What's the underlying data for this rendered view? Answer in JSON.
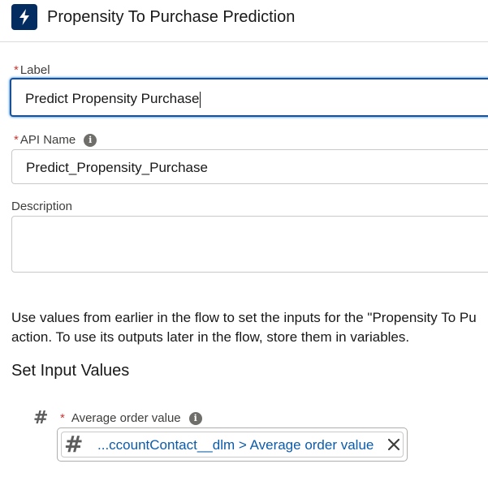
{
  "header": {
    "icon": "lightning-bolt-icon",
    "icon_color": "#032d60",
    "title": "Propensity To Purchase Prediction"
  },
  "label_field": {
    "required_mark": "*",
    "label": "Label",
    "value": "Predict Propensity Purchase"
  },
  "api_name_field": {
    "required_mark": "*",
    "label": "API Name",
    "info_icon": "info-icon",
    "value": "Predict_Propensity_Purchase"
  },
  "description_field": {
    "label": "Description",
    "value": ""
  },
  "help_text": {
    "line1": "Use values from earlier in the flow to set the inputs for the \"Propensity To Pu",
    "line2": "action. To use its outputs later in the flow, store them in variables."
  },
  "inputs_section": {
    "title": "Set Input Values",
    "items": [
      {
        "type_icon": "number-icon",
        "required_mark": "*",
        "label": "Average order value",
        "info_icon": "info-icon",
        "pill_icon": "number-icon",
        "value": "...ccountContact__dlm > Average order value",
        "remove_icon": "close-icon"
      }
    ]
  },
  "colors": {
    "accent": "#0176d3",
    "focus_border": "#1b5297",
    "required": "#c23934",
    "pill_text": "#0b5cab"
  }
}
